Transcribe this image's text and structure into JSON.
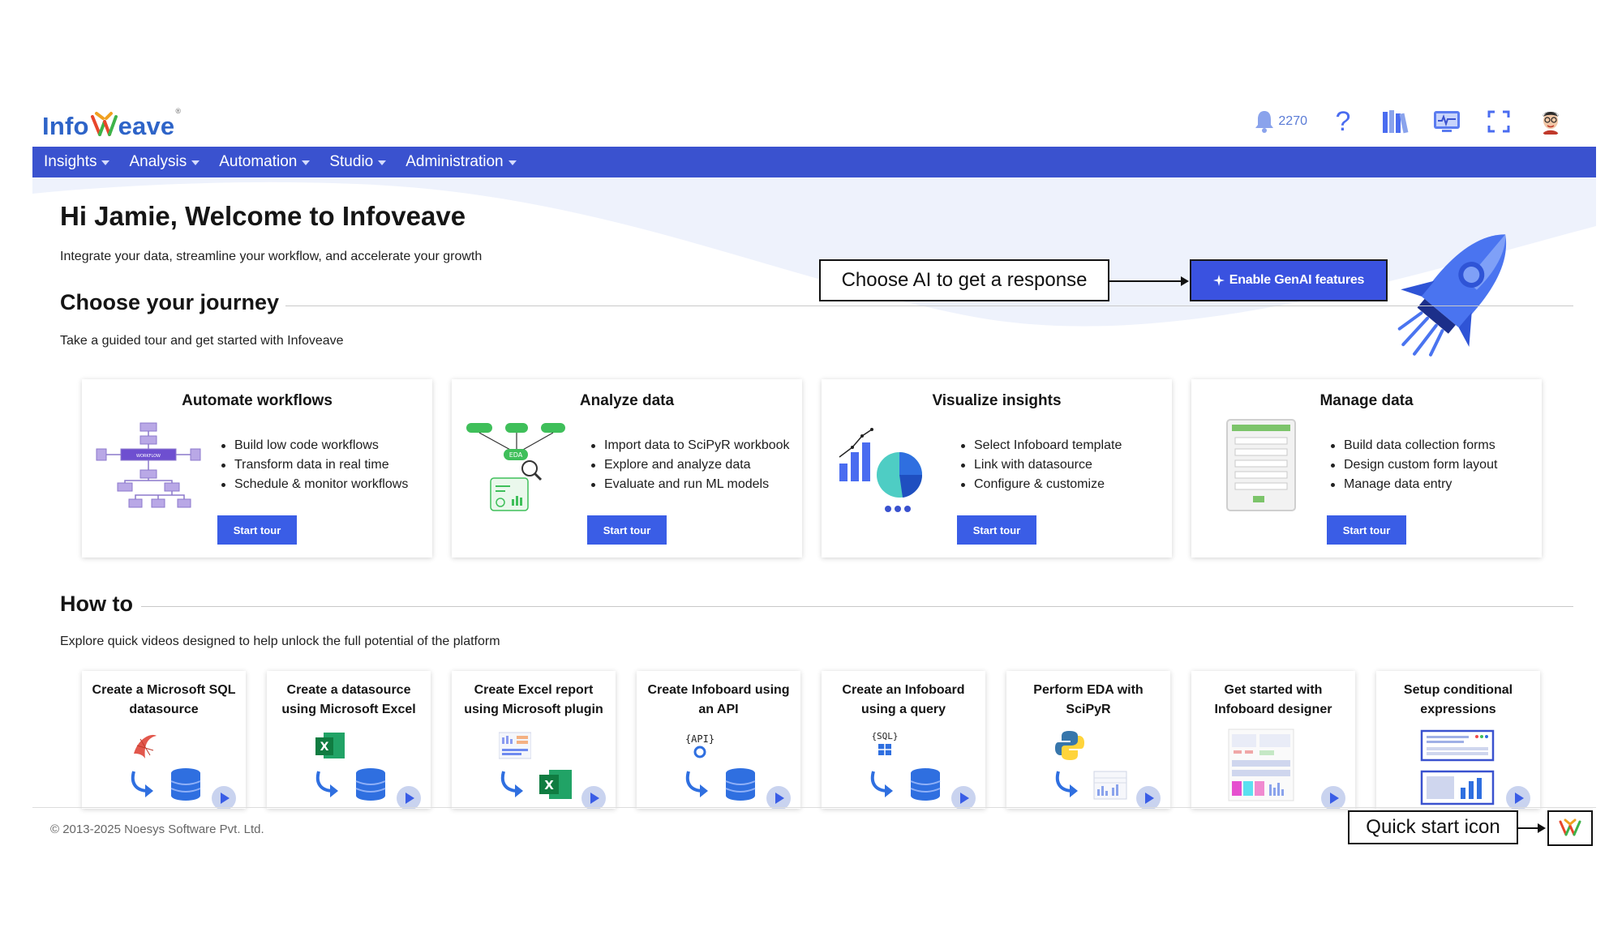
{
  "header": {
    "logo_prefix": "Info",
    "logo_suffix": "eave",
    "notification_count": "2270",
    "help_symbol": "?"
  },
  "nav": {
    "items": [
      {
        "label": "Insights"
      },
      {
        "label": "Analysis"
      },
      {
        "label": "Automation"
      },
      {
        "label": "Studio"
      },
      {
        "label": "Administration"
      }
    ]
  },
  "welcome": {
    "title": "Hi Jamie, Welcome to Infoveave",
    "subtitle": "Integrate your data, streamline your workflow, and accelerate your growth"
  },
  "genai": {
    "button_label": "Enable GenAI features",
    "callout": "Choose AI to get a response"
  },
  "journey": {
    "title": "Choose your journey",
    "subtitle": "Take a guided tour and get started with Infoveave",
    "cards": [
      {
        "title": "Automate workflows",
        "bullets": [
          "Build low code workflows",
          "Transform data in real time",
          "Schedule & monitor workflows"
        ],
        "button": "Start tour"
      },
      {
        "title": "Analyze data",
        "bullets": [
          "Import data to SciPyR workbook",
          "Explore and analyze data",
          "Evaluate and run ML models"
        ],
        "button": "Start tour"
      },
      {
        "title": "Visualize insights",
        "bullets": [
          "Select Infoboard template",
          "Link with datasource",
          "Configure & customize"
        ],
        "button": "Start tour"
      },
      {
        "title": "Manage data",
        "bullets": [
          "Build data collection forms",
          "Design custom form layout",
          "Manage data entry"
        ],
        "button": "Start tour"
      }
    ]
  },
  "howto": {
    "title": "How to",
    "subtitle": "Explore quick videos designed to help unlock the full potential of the platform",
    "cards": [
      {
        "line1": "Create a Microsoft SQL",
        "line2": "datasource"
      },
      {
        "line1": "Create a datasource",
        "line2": "using Microsoft Excel"
      },
      {
        "line1": "Create Excel report",
        "line2": "using Microsoft plugin"
      },
      {
        "line1": "Create Infoboard using",
        "line2": "an API"
      },
      {
        "line1": "Create an Infoboard",
        "line2": "using a query"
      },
      {
        "line1": "Perform EDA with",
        "line2": "SciPyR"
      },
      {
        "line1": "Get started with",
        "line2": "Infoboard designer"
      },
      {
        "line1": "Setup conditional",
        "line2": "expressions"
      }
    ]
  },
  "footer": {
    "copyright": "© 2013-2025 Noesys Software Pvt. Ltd.",
    "quick_start_callout": "Quick start icon"
  },
  "colors": {
    "nav": "#3a52cf",
    "accent": "#3a5de6",
    "brand_blue": "#2e64c8"
  }
}
